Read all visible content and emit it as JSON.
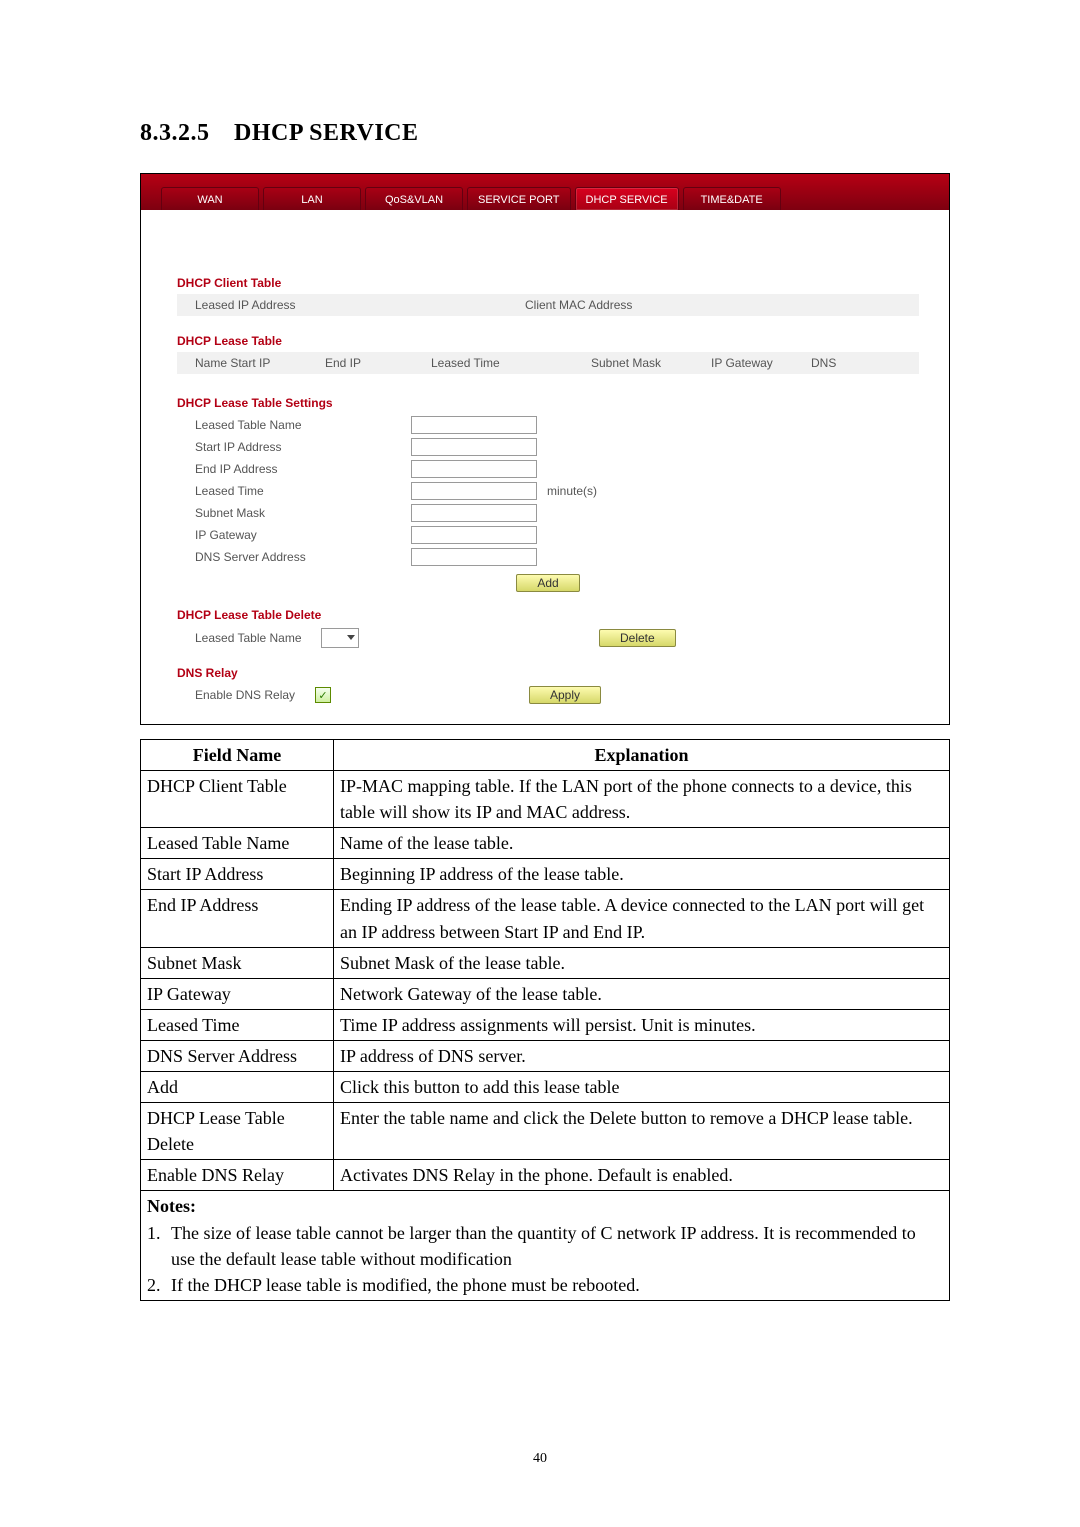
{
  "heading": {
    "number": "8.3.2.5",
    "title": "DHCP SERVICE"
  },
  "tabs": [
    "WAN",
    "LAN",
    "QoS&VLAN",
    "SERVICE PORT",
    "DHCP SERVICE",
    "TIME&DATE"
  ],
  "active_tab_index": 4,
  "sections": {
    "client_table": {
      "title": "DHCP Client Table",
      "cols": [
        "Leased IP Address",
        "Client MAC Address"
      ]
    },
    "lease_table": {
      "title": "DHCP Lease Table",
      "cols": [
        "Name Start IP",
        "End IP",
        "Leased Time",
        "Subnet Mask",
        "IP Gateway",
        "DNS"
      ]
    },
    "lease_settings": {
      "title": "DHCP Lease Table Settings",
      "fields": {
        "leased_table_name": "Leased Table Name",
        "start_ip": "Start IP Address",
        "end_ip": "End IP Address",
        "leased_time": "Leased Time",
        "leased_time_unit": "minute(s)",
        "subnet_mask": "Subnet Mask",
        "ip_gateway": "IP Gateway",
        "dns_server": "DNS Server Address"
      },
      "add_button": "Add"
    },
    "lease_delete": {
      "title": "DHCP Lease Table Delete",
      "field_label": "Leased Table Name",
      "delete_button": "Delete"
    },
    "dns_relay": {
      "title": "DNS Relay",
      "checkbox_label": "Enable DNS Relay",
      "checked": true,
      "apply_button": "Apply"
    }
  },
  "table": {
    "headers": {
      "field": "Field Name",
      "explanation": "Explanation"
    },
    "rows": [
      {
        "f": "DHCP Client Table",
        "e": "IP-MAC mapping table. If the LAN port of the phone connects to a device, this table will show its IP and MAC address."
      },
      {
        "f": "Leased Table Name",
        "e": "Name of the lease table."
      },
      {
        "f": "Start IP Address",
        "e": "Beginning IP address of the lease table."
      },
      {
        "f": "End IP Address",
        "e": "Ending IP address of the lease table.    A device connected to the LAN port will get an IP address between Start IP and End IP."
      },
      {
        "f": "Subnet Mask",
        "e": "Subnet Mask of the lease table."
      },
      {
        "f": "IP Gateway",
        "e": "Network Gateway of the lease table."
      },
      {
        "f": "Leased Time",
        "e": "Time IP address assignments will persist. Unit is minutes."
      },
      {
        "f": "DNS Server Address",
        "e": "IP address of DNS server."
      },
      {
        "f": "Add",
        "e": "Click this button to add this lease table"
      },
      {
        "f": "DHCP Lease Table Delete",
        "e": "Enter the table name and click the Delete button to remove a DHCP lease table."
      },
      {
        "f": "Enable DNS Relay",
        "e": "Activates DNS Relay in the phone.    Default is enabled."
      }
    ],
    "notes_label": "Notes:",
    "notes": [
      "The size of lease table cannot be larger than the quantity of C network IP address. It is recommended to use the default lease table without modification",
      "If the DHCP lease table is modified, the phone must be rebooted."
    ]
  },
  "page_number": "40"
}
